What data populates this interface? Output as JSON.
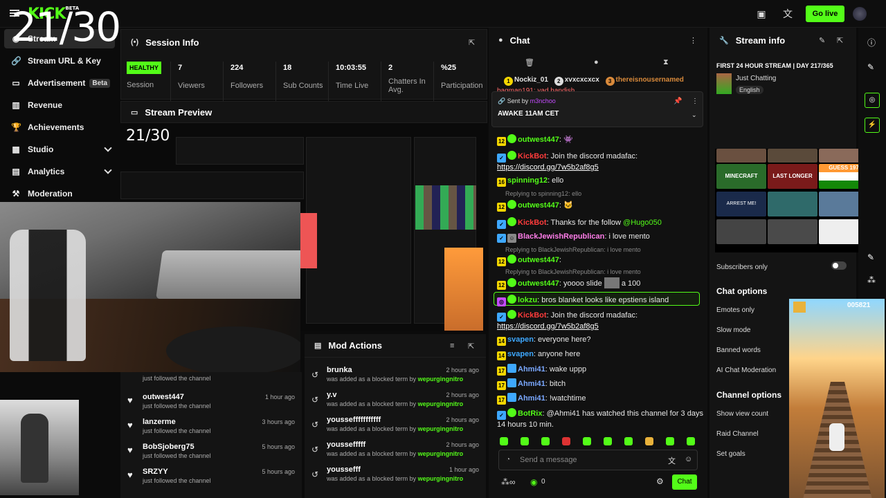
{
  "overlay_counter": "21/30",
  "preview_counter": "21/30",
  "app": {
    "logo": "KICK",
    "logo_badge": "BETA",
    "go_live": "Go live"
  },
  "sidebar": {
    "items": [
      {
        "label": "Stream"
      },
      {
        "label": "Stream URL & Key"
      },
      {
        "label": "Advertisement",
        "badge": "Beta"
      },
      {
        "label": "Revenue"
      },
      {
        "label": "Achievements"
      },
      {
        "label": "Studio"
      },
      {
        "label": "Analytics"
      },
      {
        "label": "Moderation"
      }
    ]
  },
  "session": {
    "title": "Session Info",
    "status": "HEALTHY",
    "status_label": "Session",
    "stats": [
      {
        "value": "7",
        "label": "Viewers"
      },
      {
        "value": "224",
        "label": "Followers"
      },
      {
        "value": "18",
        "label": "Sub Counts"
      },
      {
        "value": "10:03:55",
        "label": "Time Live"
      },
      {
        "value": "2",
        "label": "Chatters In Avg."
      },
      {
        "value": "%25",
        "label": "Participation"
      }
    ]
  },
  "preview": {
    "title": "Stream Preview"
  },
  "followers": [
    {
      "name": "",
      "sub": "just followed the channel",
      "time": ""
    },
    {
      "name": "outwest447",
      "sub": "just followed the channel",
      "time": "1 hour ago"
    },
    {
      "name": "lanzerme",
      "sub": "just followed the channel",
      "time": "3 hours ago"
    },
    {
      "name": "BobSjoberg75",
      "sub": "just followed the channel",
      "time": "5 hours ago"
    },
    {
      "name": "SRZYY",
      "sub": "just followed the channel",
      "time": "5 hours ago"
    }
  ],
  "mod": {
    "title": "Mod Actions",
    "rows": [
      {
        "term": "brunka",
        "text": "was added as a blocked term by",
        "by": "wepurgingnitro",
        "time": "2 hours ago"
      },
      {
        "term": "y.v",
        "text": "was added as a blocked term by",
        "by": "wepurgingnitro",
        "time": "2 hours ago"
      },
      {
        "term": "youssefffffffffff",
        "text": "was added as a blocked term by",
        "by": "wepurgingnitro",
        "time": "2 hours ago"
      },
      {
        "term": "youssefffff",
        "text": "was added as a blocked term by",
        "by": "wepurgingnitro",
        "time": "2 hours ago"
      },
      {
        "term": "youssefff",
        "text": "was added as a blocked term by",
        "by": "wepurgingnitro",
        "time": "1 hour ago"
      }
    ]
  },
  "chat": {
    "title": "Chat",
    "top": [
      {
        "name": "Nockiz_01",
        "rank": "1"
      },
      {
        "name": "xvxcxcxcx",
        "rank": "2"
      },
      {
        "name": "thereisnousernamed",
        "rank": "3"
      }
    ],
    "cutoff_line": "bagman191: yad handish",
    "pinned_by_label": "Sent by",
    "pinned_by": "m3nchoo",
    "pinned_text": "AWAKE 11AM CET",
    "messages": [
      {
        "badge": "12",
        "user": "outwest447",
        "color": "#53fc18",
        "text": ":"
      },
      {
        "user": "KickBot",
        "color": "#ff3b3b",
        "text": ": Join the discord madafac:",
        "link": "https://discord.gg/7w5b2af8g5"
      },
      {
        "badge": "16",
        "user": "spinning12",
        "color": "#53fc18",
        "text": ": ello"
      },
      {
        "reply": "Replying to spinning12: ello"
      },
      {
        "badge": "12",
        "user": "outwest447",
        "color": "#53fc18",
        "text": ":"
      },
      {
        "user": "KickBot",
        "color": "#ff3b3b",
        "text": ": Thanks for the follow ",
        "mention": "@Hugo050"
      },
      {
        "user": "BlackJewishRepublican",
        "color": "#ff7de9",
        "text": ": i love mento"
      },
      {
        "reply": "Replying to BlackJewishRepublican: i love mento"
      },
      {
        "badge": "12",
        "user": "outwest447",
        "color": "#53fc18",
        "text": ":"
      },
      {
        "reply": "Replying to BlackJewishRepublican: i love mento"
      },
      {
        "badge": "12",
        "user": "outwest447",
        "color": "#53fc18",
        "text": ": yoooo slide",
        "extra": "a 100"
      },
      {
        "user": "lokzu",
        "color": "#53fc18",
        "text": ": bros blanket looks like epstiens island"
      },
      {
        "user": "KickBot",
        "color": "#ff3b3b",
        "text": ": Join the discord madafac:",
        "link": "https://discord.gg/7w5b2af8g5"
      },
      {
        "badge": "14",
        "user": "svapen",
        "color": "#3ea8ff",
        "text": ": everyone here?"
      },
      {
        "badge": "14",
        "user": "svapen",
        "color": "#3ea8ff",
        "text": ": anyone here"
      },
      {
        "badge": "17",
        "user": "Ahmi41",
        "color": "#7aa8ff",
        "text": ": wake uppp"
      },
      {
        "badge": "17",
        "user": "Ahmi41",
        "color": "#7aa8ff",
        "text": ": bitch"
      },
      {
        "badge": "17",
        "user": "Ahmi41",
        "color": "#7aa8ff",
        "text": ": !watchtime"
      },
      {
        "user": "BotRix",
        "color": "#53fc18",
        "text": ": @Ahmi41 has watched this channel for 3 days 14 hours 10 min."
      }
    ],
    "input_placeholder": "Send a message",
    "footer_count": "0",
    "send": "Chat"
  },
  "info": {
    "title": "Stream info",
    "stream_title": "FIRST 24 HOUR STREAM | DAY 217/365",
    "category": "Just Chatting",
    "language": "English",
    "subscribers_only": "Subscribers only",
    "chat_options_title": "Chat options",
    "chat_options": [
      "Emotes only",
      "Slow mode",
      "Banned words",
      "AI Chat Moderation"
    ],
    "channel_options_title": "Channel options",
    "channel_options": [
      "Show view count",
      "Raid Channel",
      "Set goals"
    ]
  },
  "thumbs": [
    "MINECRAFT",
    "LAST LONGER NOW",
    "GUESS 197 FLAGS",
    "ARREST ME!"
  ],
  "game_score": "005821",
  "colors": {
    "accent": "#53fc18",
    "bg": "#0b0b0b",
    "panel": "#141414"
  }
}
